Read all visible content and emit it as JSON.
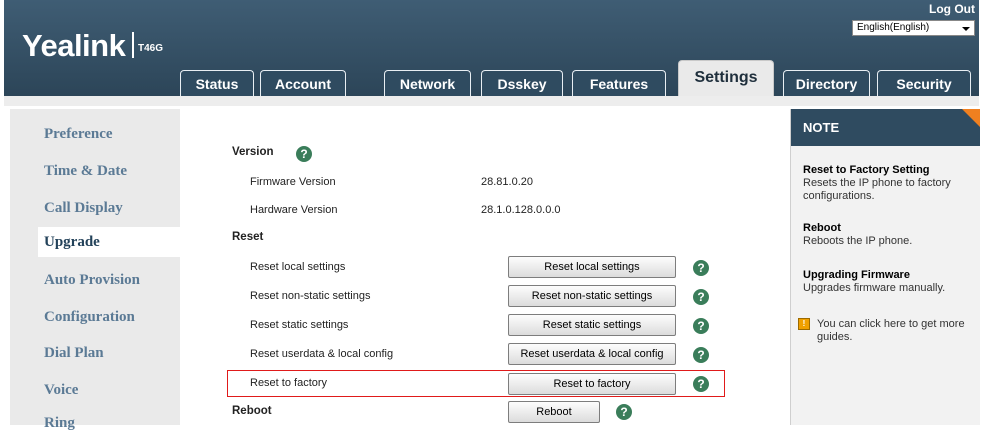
{
  "header": {
    "brand": "Yealink",
    "model": "T46G",
    "logout_label": "Log Out",
    "language": "English(English)"
  },
  "tabs": [
    {
      "label": "Status"
    },
    {
      "label": "Account"
    },
    {
      "label": "Network"
    },
    {
      "label": "Dsskey"
    },
    {
      "label": "Features"
    },
    {
      "label": "Settings",
      "active": true
    },
    {
      "label": "Directory"
    },
    {
      "label": "Security"
    }
  ],
  "sidebar": {
    "items": [
      {
        "label": "Preference"
      },
      {
        "label": "Time & Date"
      },
      {
        "label": "Call Display"
      },
      {
        "label": "Upgrade",
        "active": true
      },
      {
        "label": "Auto Provision"
      },
      {
        "label": "Configuration"
      },
      {
        "label": "Dial Plan"
      },
      {
        "label": "Voice"
      },
      {
        "label": "Ring"
      }
    ]
  },
  "main": {
    "version_section": "Version",
    "firmware_label": "Firmware Version",
    "firmware_value": "28.81.0.20",
    "hardware_label": "Hardware Version",
    "hardware_value": "28.1.0.128.0.0.0",
    "reset_section": "Reset",
    "reset_rows": [
      {
        "label": "Reset local settings",
        "button": "Reset local settings"
      },
      {
        "label": "Reset non-static settings",
        "button": "Reset non-static settings"
      },
      {
        "label": "Reset static settings",
        "button": "Reset static settings"
      },
      {
        "label": "Reset userdata & local config",
        "button": "Reset userdata & local config"
      },
      {
        "label": "Reset to factory",
        "button": "Reset to factory"
      }
    ],
    "reboot_section": "Reboot",
    "reboot_button": "Reboot",
    "help_glyph": "?"
  },
  "note": {
    "title": "NOTE",
    "items": [
      {
        "title": "Reset to Factory Setting",
        "text": "Resets the IP phone to factory configurations."
      },
      {
        "title": "Reboot",
        "text": "Reboots the IP phone."
      },
      {
        "title": "Upgrading Firmware",
        "text": "Upgrades firmware manually."
      }
    ],
    "guide_text": "You can click here to get more guides.",
    "guide_icon": "!"
  },
  "colors": {
    "header": "#2f4b60",
    "highlight": "#e01a1a",
    "accent": "#f08020",
    "help": "#3a7d5a"
  }
}
